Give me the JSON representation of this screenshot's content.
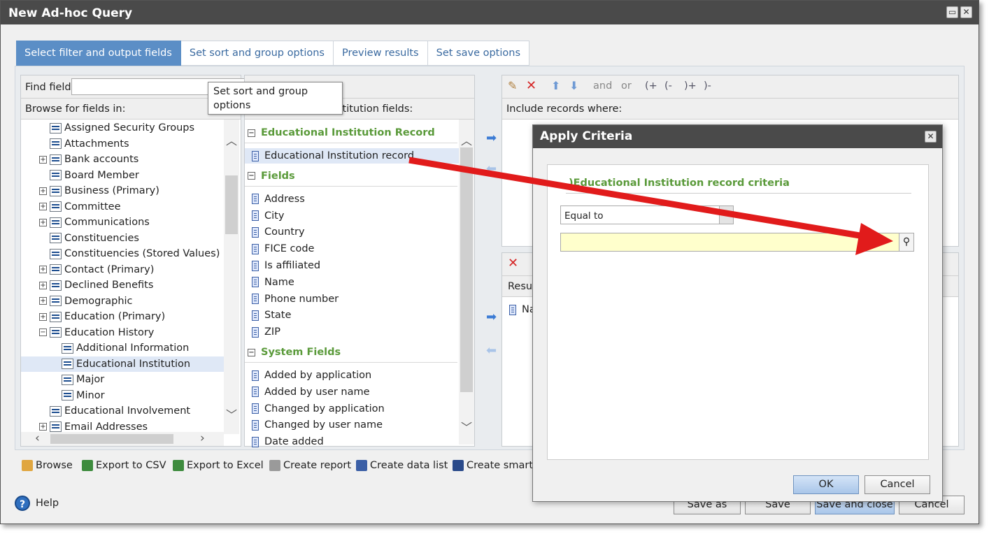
{
  "window": {
    "title": "New Ad-hoc Query",
    "restore_icon": "restore-icon",
    "close_icon": "close-icon"
  },
  "tabs": [
    {
      "label": "Select filter and output fields",
      "active": true
    },
    {
      "label": "Set sort and group options",
      "active": false
    },
    {
      "label": "Preview results",
      "active": false
    },
    {
      "label": "Set save options",
      "active": false
    }
  ],
  "left": {
    "find_label": "Find field:",
    "find_value": "",
    "browse_label": "Browse for fields in:",
    "tree": [
      {
        "label": "Assigned Security Groups",
        "expander": false,
        "indent": 0
      },
      {
        "label": "Attachments",
        "expander": false,
        "indent": 0
      },
      {
        "label": "Bank accounts",
        "expander": true,
        "indent": 0
      },
      {
        "label": "Board Member",
        "expander": false,
        "indent": 0
      },
      {
        "label": "Business (Primary)",
        "expander": true,
        "indent": 0
      },
      {
        "label": "Committee",
        "expander": true,
        "indent": 0
      },
      {
        "label": "Communications",
        "expander": true,
        "indent": 0
      },
      {
        "label": "Constituencies",
        "expander": false,
        "indent": 0
      },
      {
        "label": "Constituencies (Stored Values)",
        "expander": false,
        "indent": 0
      },
      {
        "label": "Contact (Primary)",
        "expander": true,
        "indent": 0
      },
      {
        "label": "Declined Benefits",
        "expander": true,
        "indent": 0
      },
      {
        "label": "Demographic",
        "expander": true,
        "indent": 0
      },
      {
        "label": "Education (Primary)",
        "expander": true,
        "indent": 0
      },
      {
        "label": "Education History",
        "expander": true,
        "expanded": true,
        "indent": 0
      },
      {
        "label": "Additional Information",
        "expander": false,
        "indent": 1
      },
      {
        "label": "Educational Institution",
        "expander": false,
        "indent": 1,
        "selected": true
      },
      {
        "label": "Major",
        "expander": false,
        "indent": 1
      },
      {
        "label": "Minor",
        "expander": false,
        "indent": 1
      },
      {
        "label": "Educational Involvement",
        "expander": false,
        "indent": 0
      },
      {
        "label": "Email Addresses",
        "expander": true,
        "indent": 0
      }
    ]
  },
  "middle": {
    "header_label": "stitution fields:",
    "sections": [
      {
        "title": "Educational Institution Record",
        "fields": [
          "Educational Institution record"
        ]
      },
      {
        "title": "Fields",
        "fields": [
          "Address",
          "City",
          "Country",
          "FICE code",
          "Is affiliated",
          "Name",
          "Phone number",
          "State",
          "ZIP"
        ]
      },
      {
        "title": "System Fields",
        "fields": [
          "Added by application",
          "Added by user name",
          "Changed by application",
          "Changed by user name",
          "Date added"
        ]
      }
    ]
  },
  "tooltip": "Set sort and group options",
  "right": {
    "toolbar": [
      "and",
      "or",
      "(+",
      "(-",
      ")+",
      ")-"
    ],
    "include_label": "Include records where:",
    "results_label": "Resul",
    "results_field": "Na"
  },
  "bottom_toolbar": [
    {
      "label": "Browse",
      "icon": "folder-icon",
      "color": "#e0a640"
    },
    {
      "label": "Export to CSV",
      "icon": "csv-icon",
      "color": "#3d8b3d"
    },
    {
      "label": "Export to Excel",
      "icon": "excel-icon",
      "color": "#3d8b3d"
    },
    {
      "label": "Create report",
      "icon": "report-icon",
      "color": "#9a9a9a"
    },
    {
      "label": "Create data list",
      "icon": "datalist-icon",
      "color": "#3b5fa6"
    },
    {
      "label": "Create smart q",
      "icon": "smart-query-icon",
      "color": "#2a4a8a"
    }
  ],
  "footer": {
    "help": "Help",
    "buttons": [
      "Save as",
      "Save",
      "Save and close",
      "Cancel"
    ]
  },
  "dialog": {
    "title": "Apply Criteria",
    "criteria_title": ")Educational Institution record criteria",
    "operator": "Equal to",
    "value": "",
    "ok": "OK",
    "cancel": "Cancel"
  },
  "colors": {
    "accent": "#5b8ec6",
    "section_green": "#5a9a3a",
    "arrow": "#e11b1b",
    "input_yellow": "#ffffcc"
  }
}
